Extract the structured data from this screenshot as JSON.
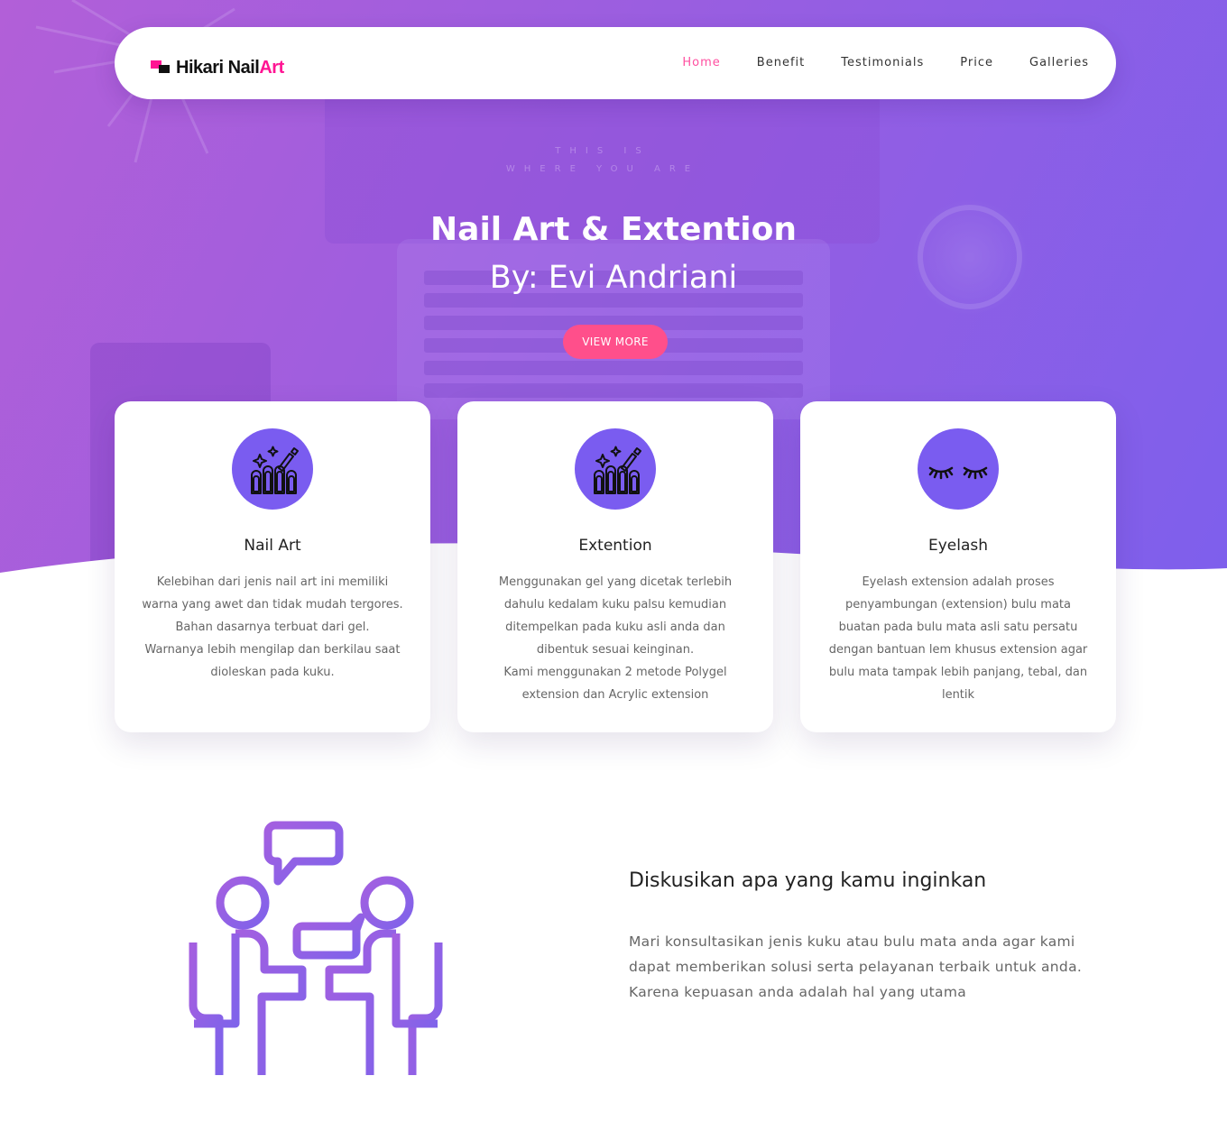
{
  "brand": {
    "name_part1": "Hikari ",
    "name_part2": "Nail",
    "name_part3": "Art",
    "accent_color": "#ff1493"
  },
  "nav": {
    "items": [
      {
        "label": "Home",
        "active": true
      },
      {
        "label": "Benefit",
        "active": false
      },
      {
        "label": "Testimonials",
        "active": false
      },
      {
        "label": "Price",
        "active": false
      },
      {
        "label": "Galleries",
        "active": false
      }
    ]
  },
  "hero": {
    "title": "Nail Art & Extention",
    "subtitle": "By: Evi Andriani",
    "button_label": "VIEW MORE",
    "gradient": [
      "#b25fd8",
      "#7e5fec"
    ],
    "button_color": "#ff4f8b"
  },
  "cards": [
    {
      "icon": "nail-polish-icon",
      "title": "Nail Art",
      "lines": [
        "Kelebihan dari jenis nail art ini memiliki",
        "warna yang awet dan tidak mudah tergores.",
        "Bahan dasarnya terbuat dari gel.",
        "Warnanya lebih mengilap dan berkilau saat",
        "dioleskan pada kuku."
      ]
    },
    {
      "icon": "nail-polish-icon",
      "title": "Extention",
      "lines": [
        "Menggunakan gel yang dicetak terlebih",
        "dahulu kedalam kuku palsu kemudian",
        "ditempelkan pada kuku asli anda dan",
        "dibentuk sesuai keinginan.",
        "Kami menggunakan 2 metode Polygel",
        "extension dan Acrylic extension"
      ]
    },
    {
      "icon": "eyelash-icon",
      "title": "Eyelash",
      "lines": [
        "Eyelash extension adalah proses",
        "penyambungan (extension) bulu mata",
        "buatan pada bulu mata asli satu persatu",
        "dengan bantuan lem khusus extension agar",
        "bulu mata tampak lebih panjang, tebal, dan",
        "lentik"
      ]
    }
  ],
  "discuss": {
    "illustration": "consultation-icon",
    "title": "Diskusikan apa yang kamu inginkan",
    "lines": [
      "Mari konsultasikan jenis kuku atau bulu mata anda agar kami",
      "dapat memberikan solusi serta pelayanan terbaik untuk anda.",
      "Karena kepuasan anda adalah hal yang utama"
    ],
    "icon_color": "#9b5de5"
  }
}
